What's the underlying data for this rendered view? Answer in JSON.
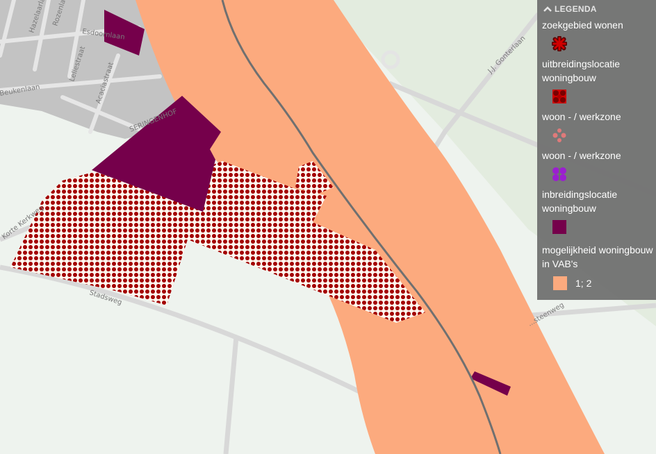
{
  "legend": {
    "title": "LEGENDA",
    "items": [
      {
        "label": "zoekgebied wonen",
        "icon": "asterisk-symbol-icon",
        "color": "#a30000"
      },
      {
        "label": "uitbreidingslocatie woningbouw",
        "icon": "dot-pattern-icon",
        "color": "#a30000"
      },
      {
        "label": "woon - / werkzone",
        "icon": "pink-dot-pattern-icon",
        "color": "#e07a7a"
      },
      {
        "label": "woon - / werkzone",
        "icon": "purple-dot-pattern-icon",
        "color": "#9b1fd0"
      },
      {
        "label": "inbreidingslocatie woningbouw",
        "icon": "solid-square-icon",
        "color": "#75004b"
      },
      {
        "label": "mogelijkheid woningbouw in VAB's",
        "icon": "peach-square-icon",
        "color": "#fcaa7e",
        "value_label": "1; 2"
      }
    ]
  },
  "streets": {
    "hazelaar": "Hazelaarlaan",
    "rozen": "Rozenlaan",
    "esdoorn": "Esdoornlaan",
    "leliestraat": "Leliestraat",
    "acacia": "Acaciastraat",
    "beuken": "Beukenlaan",
    "seringenhof": "SERINGENHOF",
    "gonterlaan": "J.J. Gonterlaan",
    "korte_kerkweg": "Korte Kerkweg",
    "stadsweg": "Stadsweg",
    "steenweg": "...steenweg"
  },
  "colors": {
    "background": "#eef3ee",
    "urban": "#bdbdbd",
    "peach": "#fcaa7e",
    "purple": "#75004b",
    "dots": "#a30000",
    "rail": "#707070"
  }
}
